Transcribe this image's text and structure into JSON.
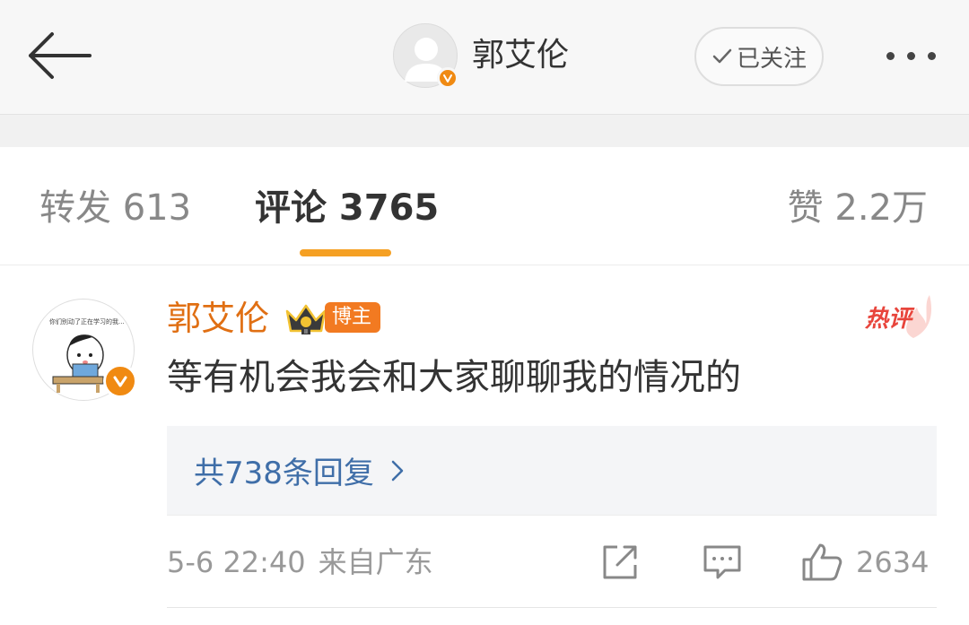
{
  "header": {
    "name": "郭艾伦",
    "follow_label": "已关注",
    "colors": {
      "verified_badge": "#f08a12",
      "background": "#f7f7f7"
    }
  },
  "tabs": [
    {
      "label": "转发 613",
      "active": false
    },
    {
      "label": "评论 3765",
      "active": true
    },
    {
      "label": "赞 2.2万",
      "active": false
    }
  ],
  "comment": {
    "avatar_caption": "你们别动了正在学习的我...",
    "author": "郭艾伦",
    "badge_label": "博主",
    "hot_tag": "热评",
    "text": "等有机会我会和大家聊聊我的情况的",
    "replies_label": "共738条回复",
    "time": "5-6 22:40",
    "location": "来自广东",
    "like_count": "2634"
  },
  "icons": [
    "back-arrow-icon",
    "verified-v-icon",
    "check-icon",
    "more-dots-icon",
    "crown-icon",
    "chevron-right-icon",
    "share-icon",
    "reply-icon",
    "thumbs-up-icon"
  ],
  "colors": {
    "accent_underline": "#f5a023",
    "author_name": "#e06f13",
    "reply_link": "#3f6ea8",
    "hot_tag": "#e8453c"
  }
}
